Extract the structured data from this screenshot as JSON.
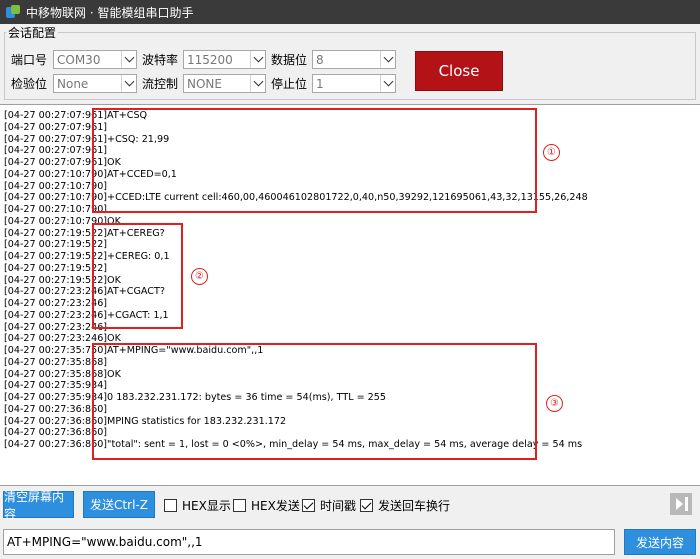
{
  "window": {
    "title": "中移物联网 · 智能模组串口助手"
  },
  "config": {
    "group_label": "会话配置",
    "port": {
      "label": "端口号",
      "value": "COM30"
    },
    "baud": {
      "label": "波特率",
      "value": "115200"
    },
    "databits": {
      "label": "数据位",
      "value": "8"
    },
    "parity": {
      "label": "检验位",
      "value": "None"
    },
    "flow": {
      "label": "流控制",
      "value": "NONE"
    },
    "stopbits": {
      "label": "停止位",
      "value": "1"
    },
    "close_label": "Close"
  },
  "log": {
    "lines": [
      {
        "ts": "[04-27 00:27:07:961]",
        "msg": "AT+CSQ"
      },
      {
        "ts": "[04-27 00:27:07:961]",
        "msg": ""
      },
      {
        "ts": "[04-27 00:27:07:961]",
        "msg": "+CSQ: 21,99"
      },
      {
        "ts": "[04-27 00:27:07:961]",
        "msg": ""
      },
      {
        "ts": "[04-27 00:27:07:961]",
        "msg": "OK"
      },
      {
        "ts": "[04-27 00:27:10:790]",
        "msg": "AT+CCED=0,1"
      },
      {
        "ts": "[04-27 00:27:10:790]",
        "msg": ""
      },
      {
        "ts": "[04-27 00:27:10:790]",
        "msg": "+CCED:LTE current cell:460,00,460046102801722,0,40,n50,39292,121695061,43,32,13155,26,248"
      },
      {
        "ts": "[04-27 00:27:10:790]",
        "msg": ""
      },
      {
        "ts": "[04-27 00:27:10:790]",
        "msg": "OK"
      },
      {
        "ts": "[04-27 00:27:19:522]",
        "msg": "AT+CEREG?"
      },
      {
        "ts": "[04-27 00:27:19:522]",
        "msg": ""
      },
      {
        "ts": "[04-27 00:27:19:522]",
        "msg": "+CEREG: 0,1"
      },
      {
        "ts": "[04-27 00:27:19:522]",
        "msg": ""
      },
      {
        "ts": "[04-27 00:27:19:522]",
        "msg": "OK"
      },
      {
        "ts": "[04-27 00:27:23:246]",
        "msg": "AT+CGACT?"
      },
      {
        "ts": "[04-27 00:27:23:246]",
        "msg": ""
      },
      {
        "ts": "[04-27 00:27:23:246]",
        "msg": "+CGACT: 1,1"
      },
      {
        "ts": "[04-27 00:27:23:246]",
        "msg": ""
      },
      {
        "ts": "[04-27 00:27:23:246]",
        "msg": "OK"
      },
      {
        "ts": "[04-27 00:27:35:750]",
        "msg": "AT+MPING=\"www.baidu.com\",,1"
      },
      {
        "ts": "[04-27 00:27:35:868]",
        "msg": ""
      },
      {
        "ts": "[04-27 00:27:35:868]",
        "msg": "OK"
      },
      {
        "ts": "[04-27 00:27:35:934]",
        "msg": ""
      },
      {
        "ts": "[04-27 00:27:35:934]",
        "msg": "0 183.232.231.172: bytes = 36 time = 54(ms), TTL = 255"
      },
      {
        "ts": "[04-27 00:27:36:860]",
        "msg": ""
      },
      {
        "ts": "[04-27 00:27:36:860]",
        "msg": "MPING statistics for 183.232.231.172"
      },
      {
        "ts": "[04-27 00:27:36:860]",
        "msg": ""
      },
      {
        "ts": "[04-27 00:27:36:860]",
        "msg": "\"total\": sent = 1, lost = 0 <0%>, min_delay = 54 ms, max_delay = 54 ms, average delay = 54 ms"
      }
    ]
  },
  "annotations": [
    "①",
    "②",
    "③"
  ],
  "toolbar": {
    "clear_label": "清空屏幕内容",
    "send_ctrlz_label": "发送Ctrl-Z",
    "hex_display": {
      "label": "HEX显示",
      "checked": false
    },
    "hex_send": {
      "label": "HEX发送",
      "checked": false
    },
    "timestamp": {
      "label": "时间戳",
      "checked": true
    },
    "send_newline": {
      "label": "发送回车换行",
      "checked": true
    }
  },
  "send": {
    "input_value": "AT+MPING=\"www.baidu.com\",,1",
    "send_label": "发送内容"
  }
}
